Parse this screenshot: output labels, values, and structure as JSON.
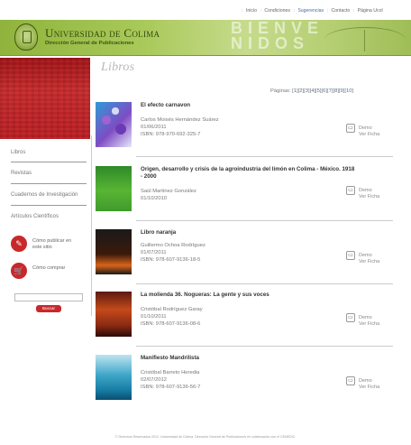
{
  "topnav": {
    "items": [
      "Inicio",
      "Condiciones",
      "Sugerencias",
      "Contacto",
      "Página Ucol"
    ],
    "separator": ":"
  },
  "header": {
    "university": "Universidad de Colima",
    "department": "Dirección General de Publicaciones",
    "welcome_line1": "BIENVE",
    "welcome_line2": "NIDOS"
  },
  "sidebar": {
    "items": [
      "Libros",
      "Revistas",
      "Cuadernos de Investigación",
      "Artículos Científicos"
    ],
    "actions": [
      {
        "label": "Cómo publicar en este sitio",
        "icon": "publish-icon"
      },
      {
        "label": "Cómo comprar",
        "icon": "cart-icon"
      }
    ],
    "search_button": "Buscar"
  },
  "main": {
    "title": "Libros",
    "pager_label": "Páginas:",
    "pages": [
      "1",
      "2",
      "3",
      "4",
      "5",
      "6",
      "7",
      "8",
      "9",
      "10"
    ]
  },
  "books": [
    {
      "title": "El efecto carnavon",
      "author": "Carlos Moisés Hernández Suárez",
      "date": "01/06/2011",
      "isbn": "ISBN: 978-970-692-325-7",
      "demo": "Demo",
      "ficha": "Ver Ficha"
    },
    {
      "title": "Origen, desarrollo y crisis de la agroindustria del limón en Colima - México. 1918 - 2000",
      "author": "Saúl Martínez González",
      "date": "01/10/2010",
      "isbn": "",
      "demo": "Demo",
      "ficha": "Ver Ficha"
    },
    {
      "title": "Libro naranja",
      "author": "Guillermo Ochoa Rodríguez",
      "date": "01/07/2011",
      "isbn": "ISBN: 978-607-9136-18-5",
      "demo": "Demo",
      "ficha": "Ver Ficha"
    },
    {
      "title": "La molienda 36. Nogueras: La gente y sus voces",
      "author": "Cristóbal Rodríguez Garay",
      "date": "01/10/2011",
      "isbn": "ISBN: 978-607-9136-08-6",
      "demo": "Demo",
      "ficha": "Ver Ficha"
    },
    {
      "title": "Manifiesto Mandrilista",
      "author": "Cristóbal Barreto Heredia",
      "date": "02/07/2012",
      "isbn": "ISBN: 978-607-9136-56-7",
      "demo": "Demo",
      "ficha": "Ver Ficha"
    }
  ],
  "footer": {
    "text": "© Derechos Reservados 2012. Universidad de Colima. Dirección General de Publicaciones en colaboración con el CENEDIC."
  }
}
